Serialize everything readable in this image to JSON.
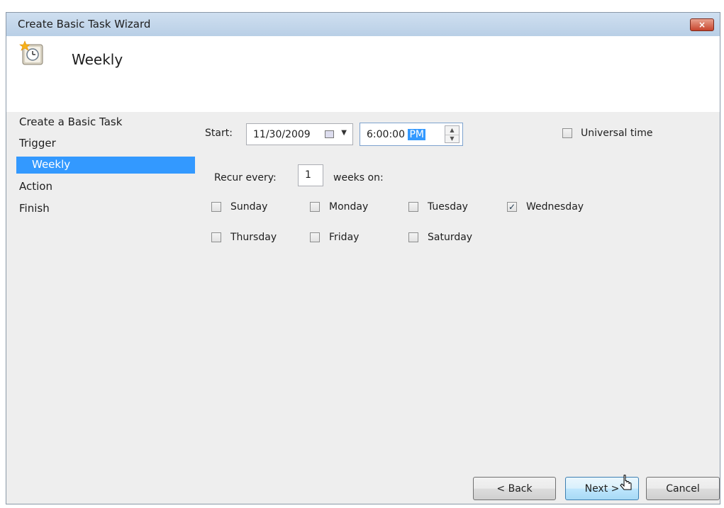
{
  "window": {
    "title": "Create Basic Task Wizard",
    "close_label": "×"
  },
  "header": {
    "icon": "clock-task-icon",
    "title": "Weekly"
  },
  "sidebar": {
    "items": [
      {
        "label": "Create a Basic Task",
        "selected": false
      },
      {
        "label": "Trigger",
        "selected": false
      },
      {
        "label": "Weekly",
        "selected": true
      },
      {
        "label": "Action",
        "selected": false
      },
      {
        "label": "Finish",
        "selected": false
      }
    ]
  },
  "start": {
    "label": "Start:",
    "date": "11/30/2009",
    "time": "6:00:00",
    "ampm": "PM"
  },
  "universal_time": {
    "label": "Universal time",
    "checked": false
  },
  "recur": {
    "label": "Recur every:",
    "value": "1",
    "suffix": "weeks on:"
  },
  "days": [
    {
      "label": "Sunday",
      "checked": false
    },
    {
      "label": "Monday",
      "checked": false
    },
    {
      "label": "Tuesday",
      "checked": false
    },
    {
      "label": "Wednesday",
      "checked": true
    },
    {
      "label": "Thursday",
      "checked": false
    },
    {
      "label": "Friday",
      "checked": false
    },
    {
      "label": "Saturday",
      "checked": false
    }
  ],
  "buttons": {
    "back": "< Back",
    "next": "Next >",
    "cancel": "Cancel"
  },
  "check_glyph": "✓"
}
